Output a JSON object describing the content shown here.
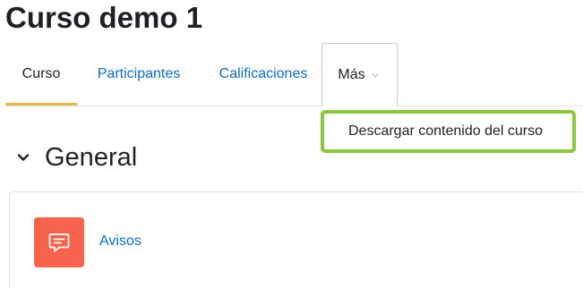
{
  "course": {
    "title": "Curso demo 1"
  },
  "tabs": [
    {
      "label": "Curso",
      "active": true
    },
    {
      "label": "Participantes",
      "active": false
    },
    {
      "label": "Calificaciones",
      "active": false
    },
    {
      "label": "Más",
      "active": false
    }
  ],
  "more_menu": {
    "items": [
      {
        "label": "Descargar contenido del curso"
      }
    ]
  },
  "section": {
    "title": "General"
  },
  "activities": [
    {
      "label": "Avisos",
      "icon": "forum-icon"
    }
  ],
  "colors": {
    "link": "#0f6cbf",
    "active_tab_underline": "#e5b44a",
    "highlight_border": "#8cc63f",
    "forum_icon_bg": "#f7634d"
  }
}
